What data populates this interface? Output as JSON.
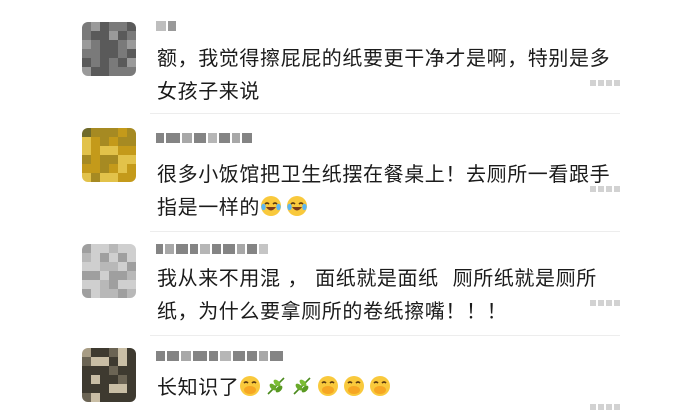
{
  "comments": [
    {
      "text_line1": "额，我觉得擦屁屁的纸要更干净才是啊，特别是多",
      "text_line2": "女孩子来说",
      "avatar_palette": [
        "#9a9a9a",
        "#e8e8e8",
        "#5a5a5a",
        "#cfcfcf",
        "#7a7a7a",
        "#f2f2f2"
      ]
    },
    {
      "text_line1": "很多小饭馆把卫生纸摆在餐桌上！去厕所一看跟手",
      "text_line2": "指是一样的",
      "emojis": [
        "laughing-crying-emoji",
        "laughing-crying-emoji"
      ],
      "avatar_palette": [
        "#c49a1a",
        "#3d4a14",
        "#e2c24a",
        "#6f6a2a",
        "#a68a22",
        "#1e2410"
      ]
    },
    {
      "text_line1": "我从来不用混 ， 面纸就是面纸  厕所纸就是厕所",
      "text_line2": "纸，为什么要拿厕所的卷纸擦嘴！！！",
      "avatar_palette": [
        "#cfcfcf",
        "#f1f1f1",
        "#9f9f9f",
        "#e0e0e0",
        "#b8b8b8",
        "#8a8a8a"
      ]
    },
    {
      "text_line1": "长知识了",
      "emojis": [
        "hand-over-mouth-emoji",
        "leaf-emoji",
        "leaf-emoji",
        "hand-over-mouth-emoji",
        "hand-over-mouth-emoji",
        "hand-over-mouth-emoji"
      ],
      "avatar_palette": [
        "#6b6454",
        "#a79c84",
        "#3e3a30",
        "#8a7e66",
        "#c9bea5",
        "#564f40"
      ]
    }
  ]
}
